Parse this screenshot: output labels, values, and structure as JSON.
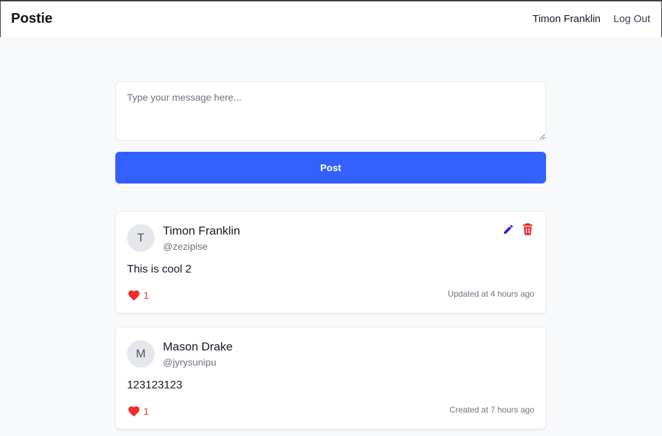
{
  "nav": {
    "brand": "Postie",
    "user_name": "Timon Franklin",
    "logout_label": "Log Out"
  },
  "composer": {
    "placeholder": "Type your message here...",
    "value": "",
    "post_label": "Post"
  },
  "colors": {
    "primary": "#3361ff",
    "like": "#ef2b2b",
    "edit": "#2a1fd1",
    "delete": "#ef2b2b"
  },
  "posts": [
    {
      "avatar_initial": "T",
      "author": "Timon Franklin",
      "handle": "@zezipise",
      "text": "This is cool 2",
      "likes": "1",
      "timestamp": "Updated at 4 hours ago",
      "can_edit": true,
      "icons": [
        "pencil-icon",
        "trash-icon",
        "heart-icon"
      ]
    },
    {
      "avatar_initial": "M",
      "author": "Mason Drake",
      "handle": "@jyrysunipu",
      "text": "123123123",
      "likes": "1",
      "timestamp": "Created at 7 hours ago",
      "can_edit": false,
      "icons": [
        "heart-icon"
      ]
    }
  ]
}
